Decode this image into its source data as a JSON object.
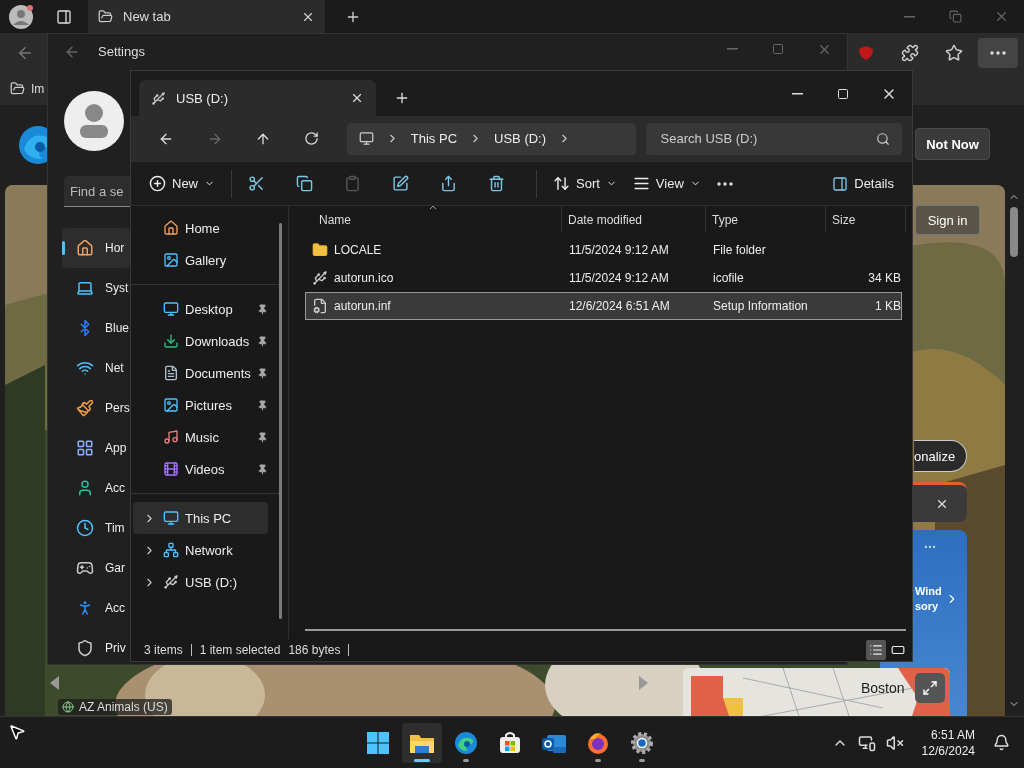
{
  "browser": {
    "tabs": [
      {
        "label": "New tab",
        "selected": true
      }
    ],
    "favorites": [
      {
        "label": "Im"
      }
    ],
    "not_now": "Not Now",
    "sign_in": "Sign in",
    "personalize": "onalize",
    "weather": {
      "lines": [
        "Wind",
        "sory"
      ]
    },
    "map": {
      "label": "Boston"
    },
    "feed_source": "AZ Animals (US)"
  },
  "settings": {
    "title": "Settings",
    "search": {
      "placeholder": "Find a se"
    },
    "nav": [
      {
        "label": "Hor",
        "selected": true
      },
      {
        "label": "Syst",
        "selected": false
      },
      {
        "label": "Blue",
        "selected": false
      },
      {
        "label": "Net",
        "selected": false
      },
      {
        "label": "Pers",
        "selected": false
      },
      {
        "label": "App",
        "selected": false
      },
      {
        "label": "Acc",
        "selected": false
      },
      {
        "label": "Tim",
        "selected": false
      },
      {
        "label": "Gar",
        "selected": false
      },
      {
        "label": "Acc",
        "selected": false
      },
      {
        "label": "Priv",
        "selected": false
      }
    ]
  },
  "explorer": {
    "tabs": [
      {
        "label": "USB (D:)",
        "selected": true
      }
    ],
    "breadcrumbs": [
      "This PC",
      "USB (D:)"
    ],
    "search": {
      "placeholder": "Search USB (D:)"
    },
    "toolbar": [
      {
        "kind": "dropdown",
        "label": "New",
        "disabled": false
      },
      {
        "kind": "icon",
        "disabled": false
      },
      {
        "kind": "icon",
        "disabled": false
      },
      {
        "kind": "icon",
        "disabled": true
      },
      {
        "kind": "icon",
        "disabled": false
      },
      {
        "kind": "icon",
        "disabled": false
      },
      {
        "kind": "icon",
        "disabled": false
      },
      {
        "kind": "dropdown",
        "label": "Sort",
        "disabled": false
      },
      {
        "kind": "dropdown",
        "label": "View",
        "disabled": false
      },
      {
        "kind": "more",
        "disabled": false
      }
    ],
    "details": {
      "label": "Details"
    },
    "nav": [
      {
        "items": [
          {
            "label": "Home",
            "pinned": false,
            "expandable": false,
            "selected": false
          },
          {
            "label": "Gallery",
            "pinned": false,
            "expandable": false,
            "selected": false
          }
        ]
      },
      {
        "items": [
          {
            "label": "Desktop",
            "pinned": true,
            "expandable": false,
            "selected": false
          },
          {
            "label": "Downloads",
            "pinned": true,
            "expandable": false,
            "selected": false
          },
          {
            "label": "Documents",
            "pinned": true,
            "expandable": false,
            "selected": false
          },
          {
            "label": "Pictures",
            "pinned": true,
            "expandable": false,
            "selected": false
          },
          {
            "label": "Music",
            "pinned": true,
            "expandable": false,
            "selected": false
          },
          {
            "label": "Videos",
            "pinned": true,
            "expandable": false,
            "selected": false
          }
        ]
      },
      {
        "items": [
          {
            "label": "This PC",
            "pinned": false,
            "expandable": true,
            "selected": true
          },
          {
            "label": "Network",
            "pinned": false,
            "expandable": true,
            "selected": false
          },
          {
            "label": "USB (D:)",
            "pinned": false,
            "expandable": true,
            "selected": false
          }
        ]
      }
    ],
    "columns": [
      {
        "label": "Name",
        "sorted": true
      },
      {
        "label": "Date modified",
        "sorted": false
      },
      {
        "label": "Type",
        "sorted": false
      },
      {
        "label": "Size",
        "sorted": false
      }
    ],
    "rows": [
      {
        "kind": "folder",
        "name": "LOCALE",
        "date": "11/5/2024 9:12 AM",
        "type": "File folder",
        "selected": false
      },
      {
        "name": "autorun.ico",
        "date": "11/5/2024 9:12 AM",
        "type": "icofile",
        "size": "34 KB",
        "selected": false
      },
      {
        "kind": "setup",
        "name": "autorun.inf",
        "date": "12/6/2024 6:51 AM",
        "type": "Setup Information",
        "size": "1 KB",
        "selected": true
      }
    ],
    "status": {
      "count": "3 items",
      "selection": "1 item selected",
      "size": "186 bytes"
    },
    "view_modes": [
      {
        "selected": true
      },
      {
        "selected": false
      }
    ]
  },
  "taskbar": {
    "apps": [
      {
        "kind": "start",
        "running": false,
        "active": false
      },
      {
        "kind": "files",
        "running": true,
        "active": true
      },
      {
        "kind": "edge",
        "running": true,
        "active": false
      },
      {
        "kind": "store",
        "running": false,
        "active": false
      },
      {
        "kind": "mail",
        "running": false,
        "active": false
      },
      {
        "kind": "firefox",
        "running": true,
        "active": false
      },
      {
        "kind": "settings",
        "running": true,
        "active": false
      }
    ],
    "time": "6:51 AM",
    "date": "12/6/2024"
  }
}
